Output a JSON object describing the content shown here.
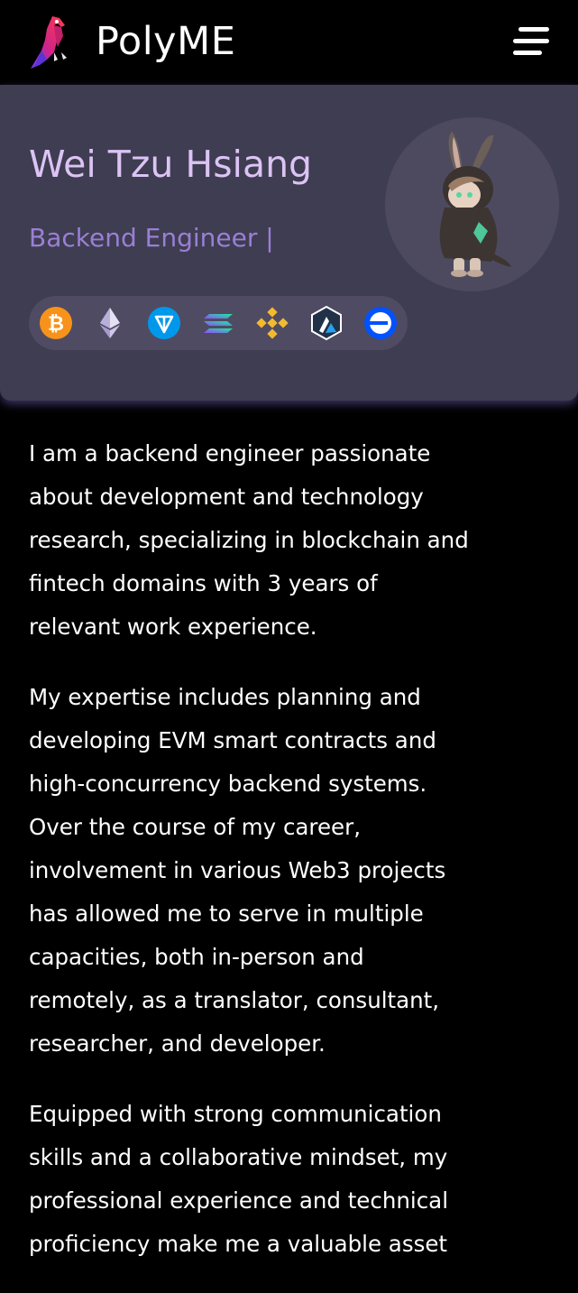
{
  "header": {
    "brand": "PolyME",
    "logo_icon": "parrot-logo-icon",
    "menu_icon": "hamburger-menu-icon"
  },
  "hero": {
    "name": "Wei Tzu Hsiang",
    "role": "Backend Engineer |",
    "avatar_icon": "bunny-hoodie-avatar",
    "chains": [
      {
        "name": "Bitcoin",
        "icon": "bitcoin-icon",
        "color": "#f7931a"
      },
      {
        "name": "Ethereum",
        "icon": "ethereum-icon",
        "color": "#ffffff"
      },
      {
        "name": "TON",
        "icon": "ton-icon",
        "color": "#0098ea"
      },
      {
        "name": "Solana",
        "icon": "solana-icon",
        "color": "#9945ff"
      },
      {
        "name": "BNB Chain",
        "icon": "bnb-icon",
        "color": "#f3ba2f"
      },
      {
        "name": "Arbitrum",
        "icon": "arbitrum-icon",
        "color": "#213147"
      },
      {
        "name": "Base",
        "icon": "base-icon",
        "color": "#0052ff"
      }
    ]
  },
  "about": {
    "paragraphs": [
      "I am a backend engineer passionate about development and technology research, specializing in blockchain and fintech domains with 3 years of relevant work experience.",
      "My expertise includes planning and developing EVM smart contracts and high-concurrency backend systems. Over the course of my career, involvement in various Web3 projects has allowed me to serve in multiple capacities, both in-person and remotely, as a translator, consultant, researcher, and developer.",
      "Equipped with strong communication skills and a collaborative mindset, my professional experience and technical proficiency make me a valuable asset"
    ]
  },
  "theme": {
    "background": "#000000",
    "hero_background": "#3f3d51",
    "name_color": "#dcc3f5",
    "role_color": "#9a7fd6",
    "text_color": "#ffffff"
  }
}
